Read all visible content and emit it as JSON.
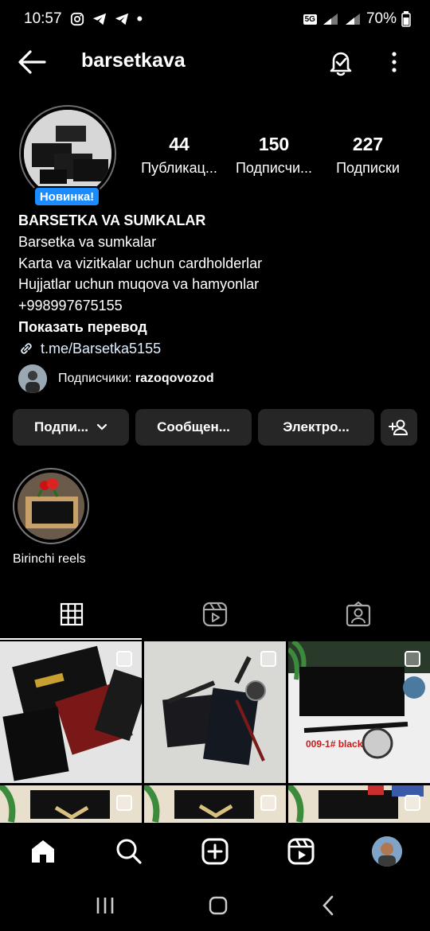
{
  "status_bar": {
    "time": "10:57",
    "battery": "70%",
    "network": "5G"
  },
  "header": {
    "username": "barsetkava"
  },
  "profile": {
    "badge": "Новинка!",
    "stats": [
      {
        "value": "44",
        "label": "Публикац..."
      },
      {
        "value": "150",
        "label": "Подписчи..."
      },
      {
        "value": "227",
        "label": "Подписки"
      }
    ],
    "bio": {
      "name": "BARSETKA VA SUMKALAR",
      "lines": [
        "Barsetka va sumkalar",
        "Karta va vizitkalar uchun cardholderlar",
        "Hujjatlar uchun muqova va hamyonlar",
        "+998997675155"
      ],
      "translate": "Показать перевод",
      "link": "t.me/Barsetka5155"
    },
    "followers": {
      "prefix": "Подписчики:",
      "name": "razoqovozod"
    }
  },
  "actions": {
    "follow": "Подпи...",
    "message": "Сообщен...",
    "email": "Электро..."
  },
  "highlights": [
    {
      "label": "Birinchi reels"
    }
  ],
  "grid": {
    "posts": [
      {
        "caption": ""
      },
      {
        "caption": ""
      },
      {
        "caption": "009-1# black"
      },
      {
        "caption": ""
      },
      {
        "caption": ""
      },
      {
        "caption": ""
      }
    ]
  },
  "colors": {
    "accent": "#1a8cff",
    "button_bg": "#262626",
    "background": "#000000"
  }
}
